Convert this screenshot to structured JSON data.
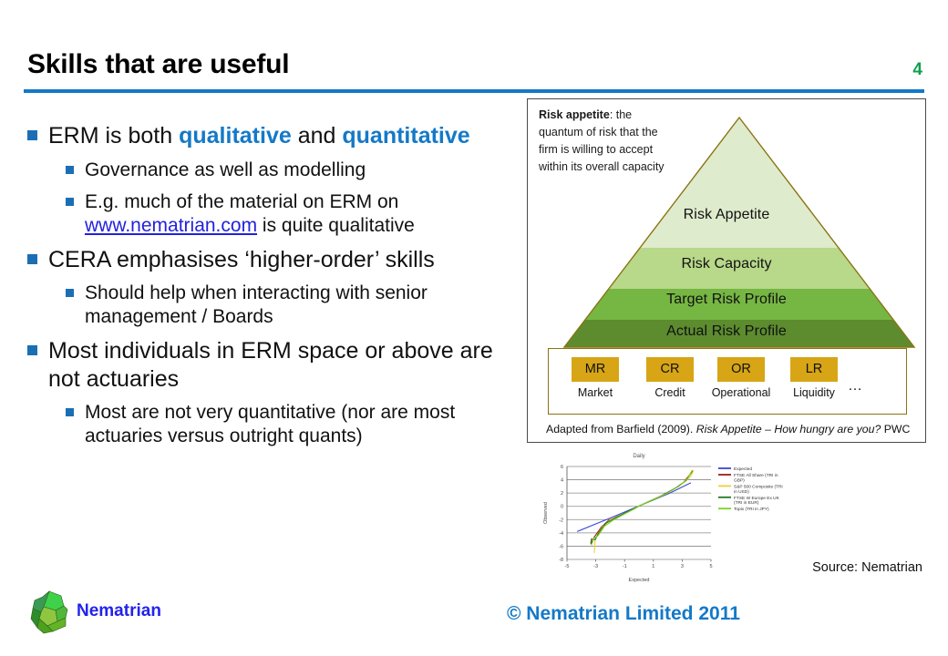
{
  "header": {
    "title": "Skills that are useful",
    "page_number": "4",
    "rule_color": "#1479c8",
    "page_number_color": "#0fa04e"
  },
  "bullets": [
    {
      "level": 1,
      "segments": [
        {
          "text": "ERM is both ",
          "style": "plain"
        },
        {
          "text": "qualitative",
          "style": "highlight"
        },
        {
          "text": " and ",
          "style": "plain"
        },
        {
          "text": "quantitative",
          "style": "highlight"
        }
      ]
    },
    {
      "level": 2,
      "segments": [
        {
          "text": "Governance as well as modelling",
          "style": "plain"
        }
      ]
    },
    {
      "level": 2,
      "segments": [
        {
          "text": "E.g. much of the material on ERM on ",
          "style": "plain"
        },
        {
          "text": "www.nematrian.com",
          "style": "link"
        },
        {
          "text": " is quite qualitative",
          "style": "plain"
        }
      ]
    },
    {
      "level": 1,
      "segments": [
        {
          "text": "CERA emphasises ‘higher-order’ skills",
          "style": "plain"
        }
      ]
    },
    {
      "level": 2,
      "segments": [
        {
          "text": "Should help when interacting with senior management / Boards",
          "style": "plain"
        }
      ]
    },
    {
      "level": 1,
      "segments": [
        {
          "text": "Most individuals in ERM space or above are not actuaries",
          "style": "plain"
        }
      ]
    },
    {
      "level": 2,
      "segments": [
        {
          "text": "Most are not very quantitative (nor are most actuaries versus outright quants)",
          "style": "plain"
        }
      ]
    }
  ],
  "pyramid": {
    "annotation_bold": "Risk appetite",
    "annotation_rest": ": the quantum of risk that the firm is willing to accept within its overall capacity",
    "bands": [
      {
        "label": "Risk Appetite",
        "color": "#dfebcd"
      },
      {
        "label": "Risk Capacity",
        "color": "#b8d88a"
      },
      {
        "label": "Target Risk Profile",
        "color": "#76b643"
      },
      {
        "label": "Actual Risk Profile",
        "color": "#5c8c2e"
      }
    ],
    "outline_color": "#8a7413",
    "risk_boxes": [
      {
        "code": "MR",
        "name": "Market"
      },
      {
        "code": "CR",
        "name": "Credit"
      },
      {
        "code": "OR",
        "name": "Operational"
      },
      {
        "code": "LR",
        "name": "Liquidity"
      }
    ],
    "risk_box_color": "#d7a515",
    "ellipsis": "…",
    "caption_pre": "Adapted from Barfield (2009). ",
    "caption_italic": "Risk Appetite – How hungry are you?",
    "caption_post": " PWC"
  },
  "chart_data": {
    "type": "line",
    "title": "Daily",
    "xlabel": "Expected",
    "ylabel": "Observed",
    "xlim": [
      -5,
      5
    ],
    "ylim": [
      -8,
      6
    ],
    "xticks": [
      -5,
      -3,
      -1,
      1,
      3,
      5
    ],
    "yticks": [
      6,
      4,
      2,
      0,
      -2,
      -4,
      -6,
      -8
    ],
    "grid": true,
    "legend_position": "right",
    "series": [
      {
        "name": "Expected",
        "color": "#3b46d8",
        "x": [
          -4.3,
          -2.2,
          0,
          2.1,
          3.6
        ],
        "y": [
          -3.8,
          -1.95,
          0.05,
          1.95,
          3.55
        ]
      },
      {
        "name": "FTSE All Share (TRI in GBP)",
        "color": "#9e1b20",
        "x": [
          -3.35,
          -3.1,
          -2.6,
          -2.1,
          -1.2,
          -0.4,
          0,
          0.7,
          1.6,
          2.5,
          3.1,
          3.5,
          3.75
        ],
        "y": [
          -5.7,
          -4.6,
          -3.1,
          -2.1,
          -1.25,
          -0.4,
          0.05,
          0.75,
          1.65,
          2.7,
          3.6,
          4.7,
          5.35
        ]
      },
      {
        "name": "S&P 500 Composite (TRI in USD)",
        "color": "#f2ce3a",
        "x": [
          -3.1,
          -3.05,
          -2.9,
          -2.5,
          -2.0,
          -1.1,
          -0.3,
          0,
          0.8,
          1.7,
          2.6,
          3.2,
          3.6,
          3.8
        ],
        "y": [
          -7.0,
          -5.2,
          -4.3,
          -3.0,
          -2.05,
          -1.2,
          -0.35,
          0.05,
          0.8,
          1.7,
          2.8,
          3.7,
          4.55,
          5.45
        ]
      },
      {
        "name": "FTSE W Europe Ex UK (TRI in EUR)",
        "color": "#1f7a25",
        "x": [
          -3.35,
          -3.3,
          -3.05,
          -2.8,
          -2.3,
          -1.6,
          -0.7,
          0,
          0.9,
          1.8,
          2.7,
          3.3,
          3.65
        ],
        "y": [
          -5.55,
          -4.9,
          -5.05,
          -4.0,
          -2.55,
          -1.7,
          -0.7,
          0.05,
          0.9,
          1.85,
          2.95,
          3.95,
          5.2
        ]
      },
      {
        "name": "Topix (TRI in JPY)",
        "color": "#7ed321",
        "x": [
          -3.3,
          -3.15,
          -2.85,
          -2.4,
          -1.8,
          -1.0,
          -0.2,
          0,
          0.9,
          1.9,
          2.8,
          3.35,
          3.7
        ],
        "y": [
          -5.85,
          -4.85,
          -4.45,
          -3.0,
          -2.1,
          -1.15,
          -0.25,
          0.05,
          0.95,
          1.9,
          3.05,
          4.1,
          5.45
        ]
      }
    ]
  },
  "source_note": "Source: Nematrian",
  "footer": {
    "logo_text": "Nematrian",
    "copyright": "© Nematrian Limited 2011"
  }
}
